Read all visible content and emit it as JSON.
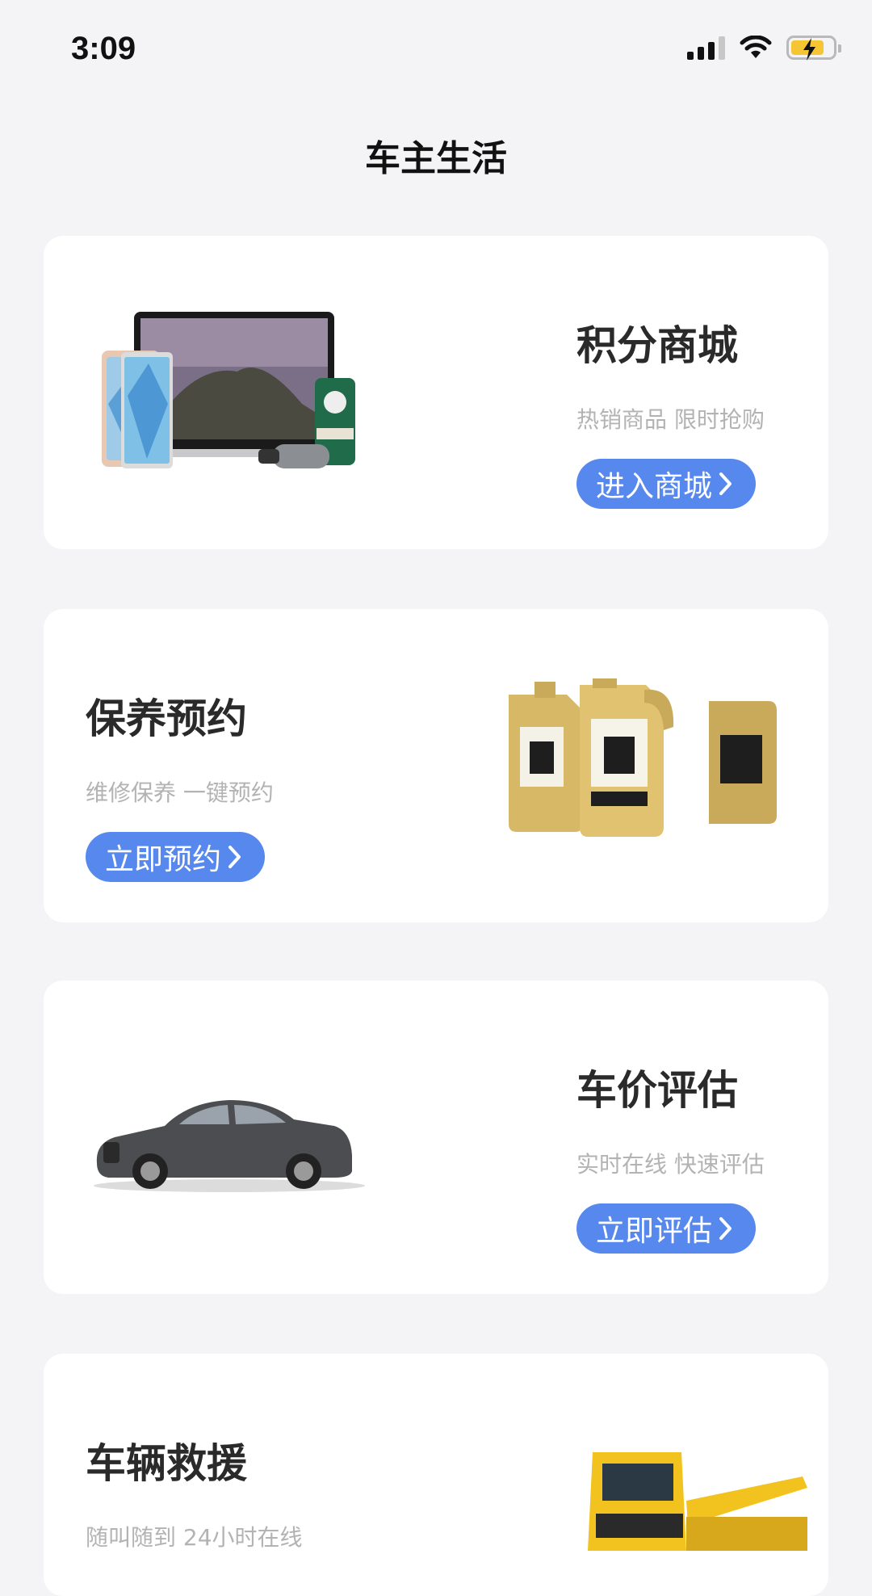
{
  "status_bar": {
    "time": "3:09",
    "icons": [
      "cellular-signal-icon",
      "wifi-icon",
      "battery-charging-icon"
    ]
  },
  "header": {
    "title": "车主生活"
  },
  "cards": [
    {
      "title": "积分商城",
      "subtitle": "热销商品 限时抢购",
      "button": "进入商城",
      "image": "electronics-products-image"
    },
    {
      "title": "保养预约",
      "subtitle": "维修保养 一键预约",
      "button": "立即预约",
      "image": "motor-oil-bottles-image"
    },
    {
      "title": "车价评估",
      "subtitle": "实时在线 快速评估",
      "button": "立即评估",
      "image": "sedan-car-image"
    },
    {
      "title": "车辆救援",
      "subtitle": "随叫随到 24小时在线",
      "button": "",
      "image": "tow-truck-image"
    }
  ],
  "colors": {
    "background": "#f4f4f6",
    "card": "#ffffff",
    "accent": "#5688ee",
    "subtitle": "#b3b3b3",
    "battery": "#f5c533"
  }
}
